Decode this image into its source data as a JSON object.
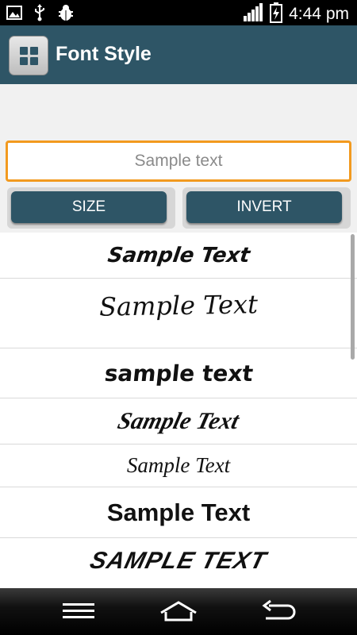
{
  "status_bar": {
    "time": "4:44 pm",
    "left_icons": [
      "gallery-icon",
      "usb-icon",
      "debug-icon"
    ],
    "right_icons": [
      "signal-icon",
      "battery-charging-icon"
    ]
  },
  "app_bar": {
    "title": "Font Style",
    "icon": "grid-app-icon",
    "color": "#2e5566"
  },
  "sample_input": {
    "placeholder": "Sample text",
    "value": ""
  },
  "buttons": {
    "size_label": "SIZE",
    "invert_label": "INVERT"
  },
  "font_list": {
    "items": [
      {
        "text": "Sample Text"
      },
      {
        "text": "Sample Text"
      },
      {
        "text": "sample text"
      },
      {
        "text": "Sample Text"
      },
      {
        "text": "Sample Text"
      },
      {
        "text": "Sample Text"
      },
      {
        "text": "SAMPLE TEXT"
      }
    ]
  },
  "nav_bar": {
    "icons": [
      "menu-icon",
      "home-icon",
      "back-icon"
    ]
  },
  "colors": {
    "accent": "#f29a1f",
    "primary": "#2e5566"
  }
}
